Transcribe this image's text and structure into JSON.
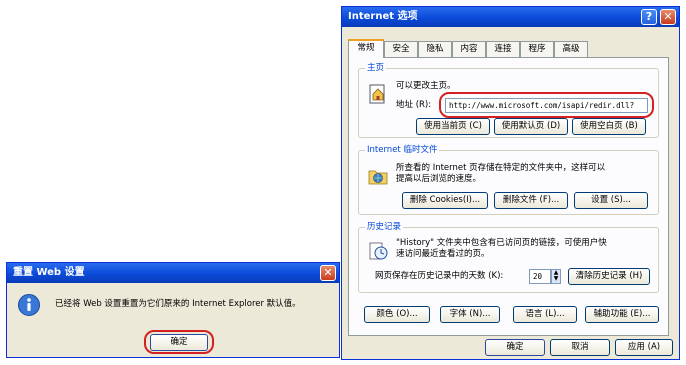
{
  "ie_options": {
    "title": "Internet 选项",
    "tabs": [
      "常规",
      "安全",
      "隐私",
      "内容",
      "连接",
      "程序",
      "高级"
    ],
    "home": {
      "group_label": "主页",
      "description": "可以更改主页。",
      "address_label": "地址 (R):",
      "address_value": "http://www.microsoft.com/isapi/redir.dll?",
      "buttons": [
        "使用当前页 (C)",
        "使用默认页 (D)",
        "使用空白页 (B)"
      ]
    },
    "temp_files": {
      "group_label": "Internet 临时文件",
      "description_line1": "所查看的 Internet 页存储在特定的文件夹中，这样可以",
      "description_line2": "提高以后浏览的速度。",
      "buttons": [
        "删除 Cookies(I)...",
        "删除文件 (F)...",
        "设置 (S)..."
      ]
    },
    "history": {
      "group_label": "历史记录",
      "description_line1": "\"History\" 文件夹中包含有已访问页的链接，可使用户快",
      "description_line2": "速访问最近查看过的页。",
      "days_label": "网页保存在历史记录中的天数 (K):",
      "days_value": "20",
      "clear_button": "清除历史记录 (H)"
    },
    "bottom_buttons": [
      "颜色 (O)...",
      "字体 (N)...",
      "语言 (L)...",
      "辅助功能 (E)..."
    ],
    "dialog_buttons": [
      "确定",
      "取消",
      "应用 (A)"
    ]
  },
  "reset_dialog": {
    "title": "重置 Web 设置",
    "message": "已经将 Web 设置重置为它们原来的 Internet Explorer 默认值。",
    "ok_label": "确定"
  }
}
